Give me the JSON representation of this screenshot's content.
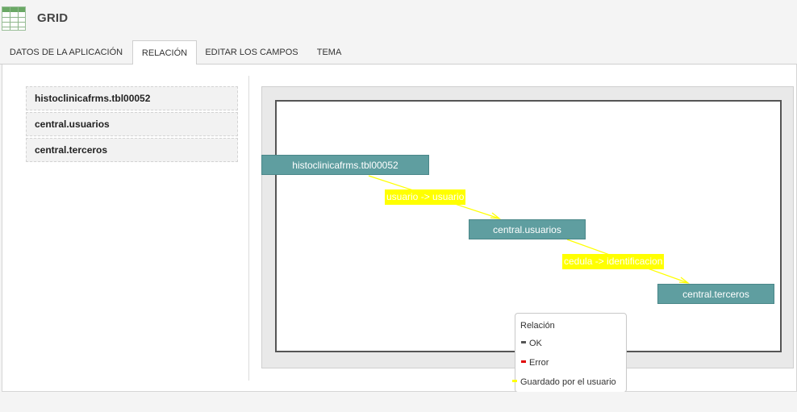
{
  "app": {
    "title": "GRID",
    "icon": "spreadsheet-grid-icon"
  },
  "tabs": [
    {
      "label": "DATOS DE LA APLICACIÓN",
      "active": false
    },
    {
      "label": "RELACIÓN",
      "active": true
    },
    {
      "label": "EDITAR LOS CAMPOS",
      "active": false
    },
    {
      "label": "TEMA",
      "active": false
    }
  ],
  "tables": [
    "histoclinicafrms.tbl00052",
    "central.usuarios",
    "central.terceros"
  ],
  "diagram": {
    "nodes": [
      "histoclinicafrms.tbl00052",
      "central.usuarios",
      "central.terceros"
    ],
    "relations": [
      {
        "label": "usuario -> usuario",
        "status": "saved_by_user"
      },
      {
        "label": "cedula -> identificacion",
        "status": "saved_by_user"
      }
    ]
  },
  "legend": {
    "title": "Relación",
    "items": [
      {
        "label": "OK",
        "color": "#555555"
      },
      {
        "label": "Error",
        "color": "#e00000"
      },
      {
        "label": "Guardado por el usuario",
        "color": "#ffff00"
      }
    ]
  },
  "colors": {
    "node": "#5f9ea0",
    "edge_saved": "#ffff00"
  }
}
